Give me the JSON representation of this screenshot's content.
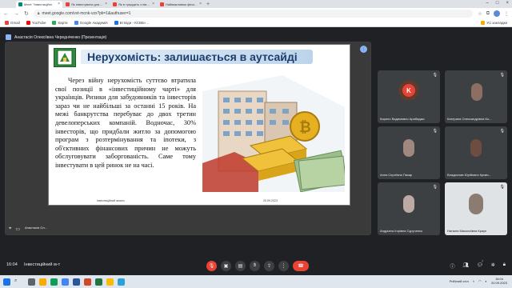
{
  "browser": {
    "tabs": [
      {
        "label": "Meet: \"Інвестиційні",
        "color": "#00897b",
        "active": true
      },
      {
        "label": "Як інвестувати для початківців",
        "color": "#ea4335",
        "active": false
      },
      {
        "label": "Як в тридцять з інвестиціями",
        "color": "#ea4335",
        "active": false
      },
      {
        "label": "Найважливіші фінансові",
        "color": "#ea4335",
        "active": false
      }
    ],
    "url": "meet.google.com/vvt-mcnk-vzx?pli=1&authuser=1",
    "bookmarks": [
      {
        "label": "Gmail",
        "color": "#ea4335"
      },
      {
        "label": "YouTube",
        "color": "#ff0000"
      },
      {
        "label": "Карти",
        "color": "#34a853"
      },
      {
        "label": "Google Академія",
        "color": "#4285f4"
      },
      {
        "label": "ВІ Біди › КСВБ»...",
        "color": "#1a73e8"
      }
    ],
    "bookmarks_right": "Усі закладки"
  },
  "meeting": {
    "presenter_label": "Анастасія Олексіївна Чередніченко (Презентація)",
    "presenter_short": "Анастасія Ол...",
    "time": "16:04",
    "title": "Інвестиційний м-т"
  },
  "slide": {
    "title": "Нерухомість: залишається в аутсайді",
    "body": "Через війну нерухомість суттєво втратила свої позиції в «інвестиційному чарті» для українців. Ризики для забудовників та інвесторів зараз чи не найбільші за останні 15 років. На межі банкрутства перебуває до двох третин девелоперських компаній. Водночас, 30% інвесторів, що придбали житло за допомогою програм з розтермінування та іпотеки, з об'єктивних фінансових причин не можуть обслуговувати заборгованість. Саме тому інвестувати в цей ринок не на часі.",
    "footer_left": "Інвестиційний аналіз",
    "footer_right": "20.09.2023"
  },
  "participants": [
    {
      "name": "Кирило Вадимович Арабаджи",
      "avatar": "K",
      "avatar_color": "#ea4335"
    },
    {
      "name": "Катерина Олександрівна Ко...",
      "avatar": "",
      "avatar_color": "#8d6e63"
    },
    {
      "name": "Анна Сергіївна Пахар",
      "avatar": "",
      "avatar_color": "#a1887f"
    },
    {
      "name": "Владислав Юрійович Кривч...",
      "avatar": "",
      "avatar_color": "#6d4c41"
    },
    {
      "name": "Андріана Ігорівна Сурученко",
      "avatar": "",
      "avatar_color": "#bcaaa4"
    },
    {
      "name": "Наталія Миколаївна Краун",
      "avatar": "",
      "avatar_color": "#cfd8dc"
    }
  ],
  "controls": {
    "badge": "7",
    "tray_lang": "Робочий стіл",
    "clock_time": "16:04",
    "clock_date": "20.09.2023"
  }
}
